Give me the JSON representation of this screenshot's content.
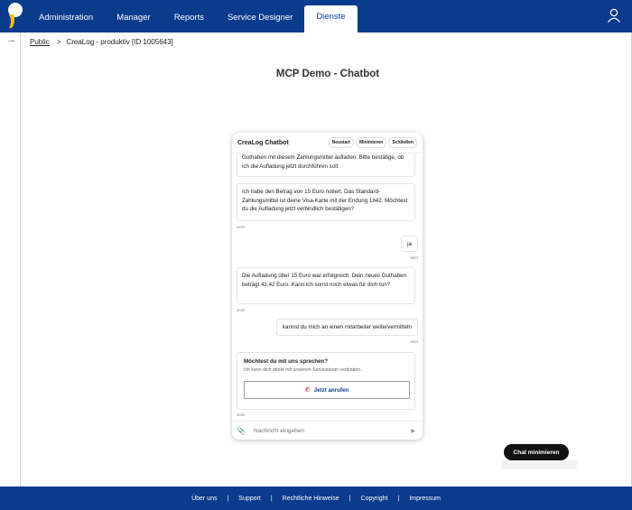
{
  "nav": {
    "items": [
      "Administration",
      "Manager",
      "Reports",
      "Service Designer",
      "Dienste"
    ],
    "active_index": 4
  },
  "breadcrumb": {
    "root": "Public",
    "separator": ">",
    "current": "CreaLog - produktiv [ID 1005643]"
  },
  "page": {
    "title": "MCP Demo - Chatbot"
  },
  "chat": {
    "title": "CreaLog Chatbot",
    "buttons": {
      "restart": "Neustart",
      "minimize": "Minimieren",
      "close": "Schließen"
    },
    "messages": [
      {
        "from": "bot",
        "text": "Guthaben mit diesem Zahlungsmittel aufladen. Bitte bestätige, ob ich die Aufladung jetzt durchführen soll."
      },
      {
        "from": "bot",
        "text": "Ich habe den Betrag von 15 Euro notiert. Das Standard-Zahlungsmittel ist deine Visa-Karte mit der Endung 1842. Möchtest du die Aufladung jetzt verbindlich bestätigen?",
        "time": "Jetzt"
      },
      {
        "from": "user",
        "text": "ja",
        "time": "Jetzt"
      },
      {
        "from": "bot",
        "text": "Die Aufladung über 15 Euro war erfolgreich. Dein neues Guthaben beträgt 41,42 Euro. Kann ich sonst noch etwas für dich tun?",
        "time": "Jetzt"
      },
      {
        "from": "user",
        "text": "kannst du mich an einen mitarbeiter weitervermitteln",
        "time": "Jetzt"
      }
    ],
    "call_card": {
      "title": "Möchtest du mit uns sprechen?",
      "text": "Ich kann dich direkt mit unserem Serviceteam verbinden.",
      "button": "Jetzt anrufen",
      "time": "Jetzt"
    },
    "input_placeholder": "Nachricht eingeben"
  },
  "minimize_pill": "Chat minimieren",
  "footer": {
    "links": [
      "Über uns",
      "Support",
      "Rechtliche Hinweise",
      "Copyright",
      "Impressum"
    ]
  },
  "colors": {
    "brand": "#0b3b8c",
    "call_icon": "#d0021b"
  }
}
